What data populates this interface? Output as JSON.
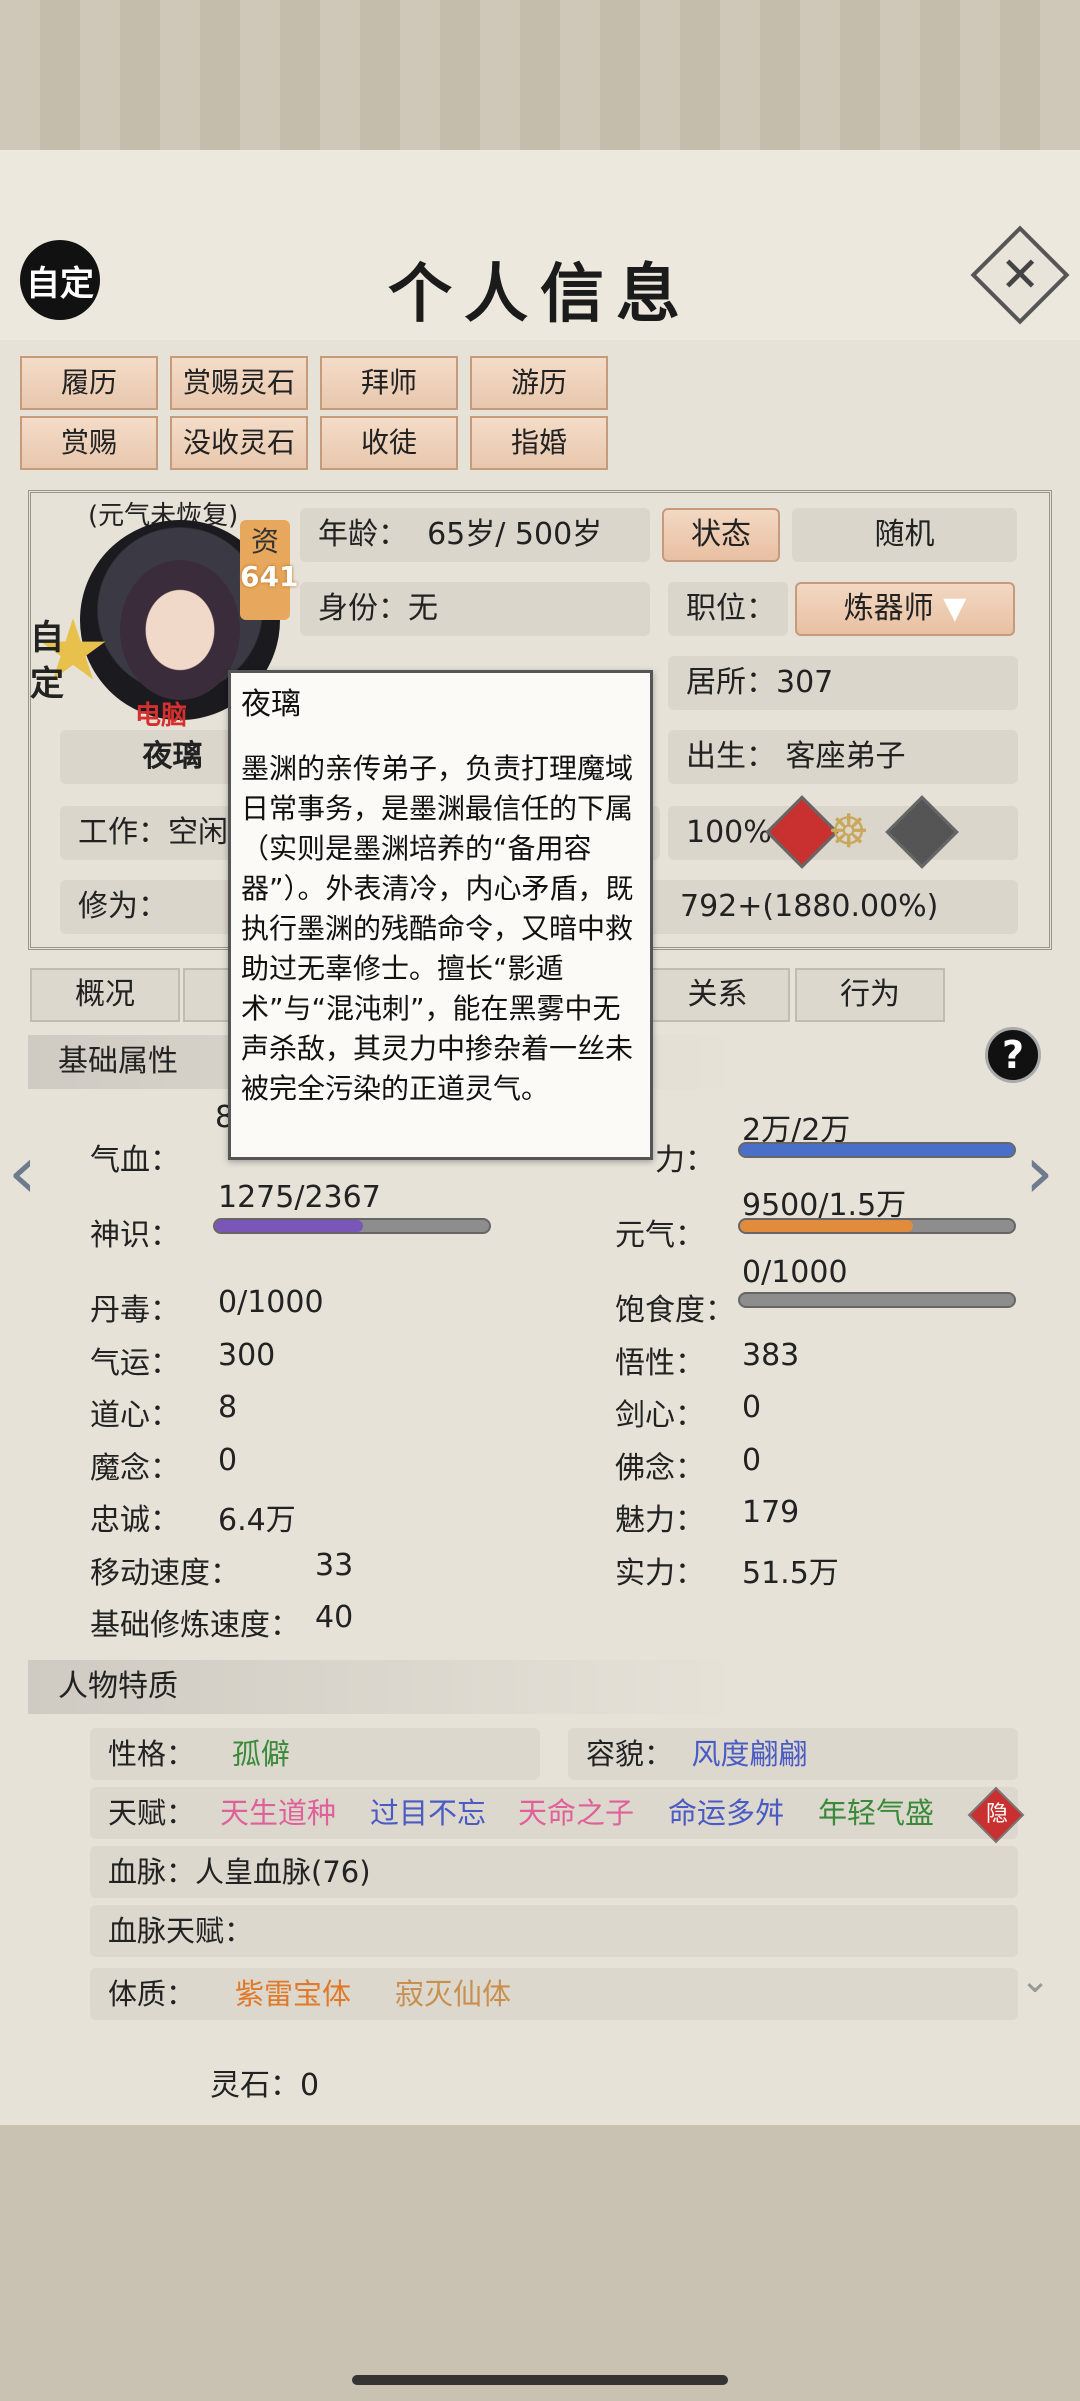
{
  "header": {
    "title": "个人信息",
    "auto_label": "自定",
    "close_symbol": "✕"
  },
  "action_buttons": [
    {
      "label": "履历"
    },
    {
      "label": "赏赐灵石"
    },
    {
      "label": "拜师"
    },
    {
      "label": "游历"
    },
    {
      "label": "赏赐"
    },
    {
      "label": "没收灵石"
    },
    {
      "label": "收徒"
    },
    {
      "label": "指婚"
    }
  ],
  "avatar": {
    "status_note": "(元气未恢复)",
    "zi_label": "资",
    "zi_value": "641",
    "badge": "自定",
    "controller": "电脑",
    "name": "夜璃"
  },
  "info": {
    "age_label": "年龄：",
    "age_value": "65岁/ 500岁",
    "state_button": "状态",
    "random_button": "随机",
    "identity_label": "身份：",
    "identity_value": "无",
    "job_label": "职位：",
    "job_value": "炼器师",
    "residence": "居所：307",
    "birth_label": "出生：",
    "birth_value": "客座弟子",
    "work_label": "工作：空闲",
    "percent": "100%",
    "cultivation_label": "修为：",
    "cultivation_value": "792+(1880.00%)"
  },
  "tooltip": {
    "name": "夜璃",
    "text": "墨渊的亲传弟子，负责打理魔域日常事务，是墨渊最信任的下属（实则是墨渊培养的“备用容器”）。外表清冷，内心矛盾，既执行墨渊的残酷命令，又暗中救助过无辜修士。擅长“影遁术”与“混沌刺”，能在黑雾中无声杀敌，其灵力中掺杂着一丝未被完全污染的正道灵气。"
  },
  "tabs": [
    {
      "label": "概况"
    },
    {
      "label": ""
    },
    {
      "label": "关系"
    },
    {
      "label": "行为"
    }
  ],
  "basic": {
    "header": "基础属性",
    "help": "?",
    "qixue_label": "气血：",
    "qixue_value": "8",
    "lingli_label": "灵力：",
    "lingli_partial": "力：",
    "lingli_value": "2万/2万",
    "lingli_fill": 1.0,
    "shenshi_label": "神识：",
    "shenshi_value": "1275/2367",
    "shenshi_fill": 0.54,
    "yuanqi_label": "元气：",
    "yuanqi_value": "9500/1.5万",
    "yuanqi_fill": 0.63,
    "baoshi_label": "饱食度：",
    "baoshi_value": "0/1000",
    "baoshi_fill": 0.0,
    "stats_left": [
      {
        "label": "丹毒：",
        "value": "0/1000"
      },
      {
        "label": "气运：",
        "value": "300"
      },
      {
        "label": "道心：",
        "value": "8"
      },
      {
        "label": "魔念：",
        "value": "0"
      },
      {
        "label": "忠诚：",
        "value": "6.4万"
      },
      {
        "label": "移动速度：",
        "value": "33"
      },
      {
        "label": "基础修炼速度：",
        "value": "40"
      }
    ],
    "stats_right": [
      {
        "label": "悟性：",
        "value": "383"
      },
      {
        "label": "剑心：",
        "value": "0"
      },
      {
        "label": "佛念：",
        "value": "0"
      },
      {
        "label": "魅力：",
        "value": "179"
      },
      {
        "label": "实力：",
        "value": "51.5万"
      }
    ]
  },
  "traits": {
    "header": "人物特质",
    "personality_label": "性格：",
    "personality_value": "孤僻",
    "looks_label": "容貌：",
    "looks_value": "风度翩翩",
    "talent_label": "天赋：",
    "talents": [
      {
        "text": "天生道种",
        "color": "#e0609a"
      },
      {
        "text": "过目不忘",
        "color": "#4a5bc4"
      },
      {
        "text": "天命之子",
        "color": "#e0609a"
      },
      {
        "text": "命运多舛",
        "color": "#4a5bc4"
      },
      {
        "text": "年轻气盛",
        "color": "#3a8a3a"
      }
    ],
    "hide_label": "隐",
    "bloodline": "血脉：人皇血脉(76)",
    "bloodline_talent": "血脉天赋：",
    "physique_label": "体质：",
    "physiques": [
      {
        "text": "紫雷宝体",
        "color": "#e07a2a"
      },
      {
        "text": "寂灭仙体",
        "color": "#c89050"
      }
    ]
  },
  "footer": {
    "lingshi": "灵石：0"
  },
  "colors": {
    "lingli": "#4a6fc9",
    "shenshi": "#7a56b8",
    "yuanqi": "#e08c3c"
  }
}
